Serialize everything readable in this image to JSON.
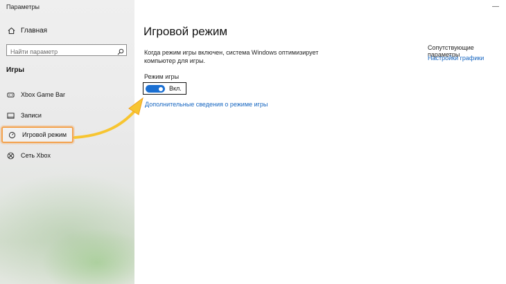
{
  "window": {
    "title": "Параметры",
    "controls": "—"
  },
  "sidebar": {
    "home_label": "Главная",
    "search_placeholder": "Найти параметр",
    "section_title": "Игры",
    "items": [
      {
        "label": "Xbox Game Bar",
        "icon": "xbox-game-bar-icon"
      },
      {
        "label": "Записи",
        "icon": "captures-icon"
      },
      {
        "label": "Игровой режим",
        "icon": "game-mode-icon",
        "active": true
      },
      {
        "label": "Сеть Xbox",
        "icon": "xbox-icon"
      }
    ]
  },
  "main": {
    "title": "Игровой режим",
    "description": "Когда режим игры включен, система Windows оптимизирует компьютер для игры.",
    "toggle": {
      "label": "Режим игры",
      "state_label": "Вкл.",
      "on": true
    },
    "more_link": "Дополнительные сведения о режиме игры"
  },
  "related": {
    "title": "Сопутствующие параметры",
    "link": "Настройки графики"
  },
  "colors": {
    "accent": "#1a6fd2",
    "link": "#1565c0",
    "highlight": "#f4a14b",
    "arrow": "#f7c531"
  }
}
